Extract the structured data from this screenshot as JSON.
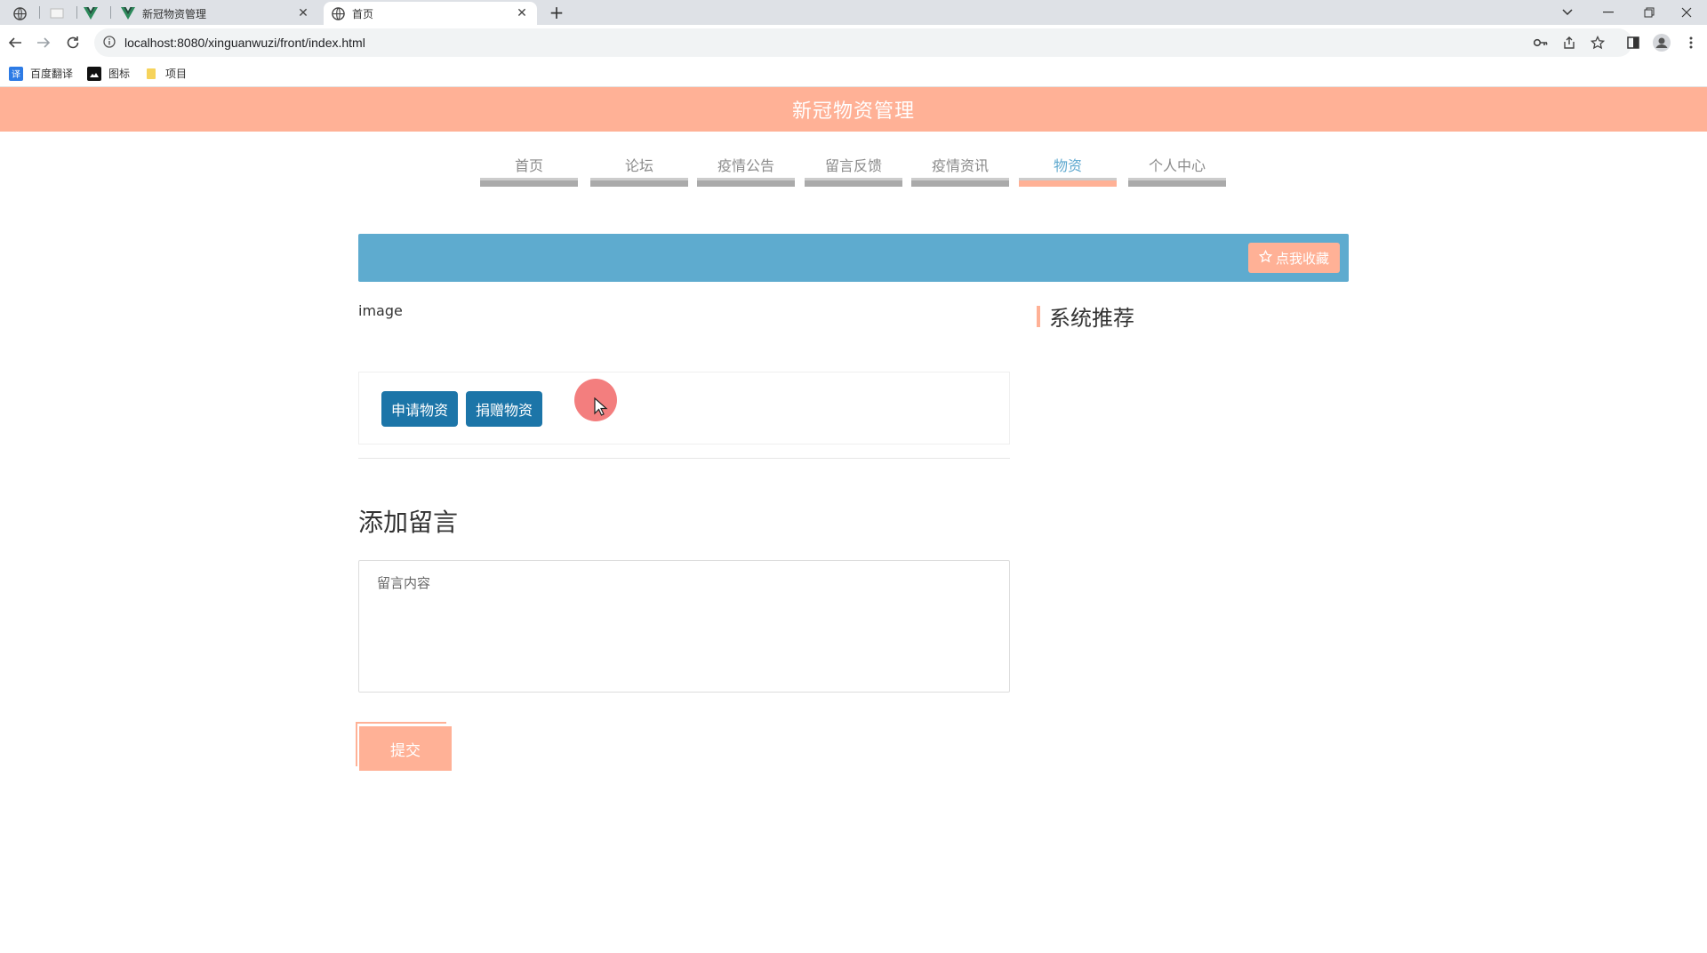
{
  "browser": {
    "tabs": [
      {
        "label": ""
      },
      {
        "label": ""
      },
      {
        "label": ""
      },
      {
        "label": "新冠物资管理",
        "close": "✕"
      },
      {
        "label": "首页",
        "close": "✕",
        "active": true
      }
    ],
    "new_tab": "+",
    "url": "localhost:8080/xinguanwuzi/front/index.html",
    "bookmarks": [
      {
        "label": "百度翻译",
        "icon": "translate-icon"
      },
      {
        "label": "图标",
        "icon": "image-icon"
      },
      {
        "label": "项目",
        "icon": "folder-icon"
      }
    ]
  },
  "site": {
    "title": "新冠物资管理"
  },
  "nav": {
    "items": [
      {
        "label": "首页"
      },
      {
        "label": "论坛"
      },
      {
        "label": "疫情公告"
      },
      {
        "label": "留言反馈"
      },
      {
        "label": "疫情资讯"
      },
      {
        "label": "物资",
        "active": true
      },
      {
        "label": "个人中心"
      }
    ]
  },
  "banner": {
    "favorite_label": "点我收藏",
    "favorite_icon": "star-icon"
  },
  "detail": {
    "image_alt": "image",
    "apply_label": "申请物资",
    "donate_label": "捐赠物资"
  },
  "recommend": {
    "title": "系统推荐"
  },
  "message": {
    "title": "添加留言",
    "placeholder": "留言内容",
    "submit_label": "提交"
  },
  "colors": {
    "header": "#ffb196",
    "banner": "#5eabcf",
    "action_button": "#1c75a8",
    "nav_active_text": "#5fa9cf"
  }
}
